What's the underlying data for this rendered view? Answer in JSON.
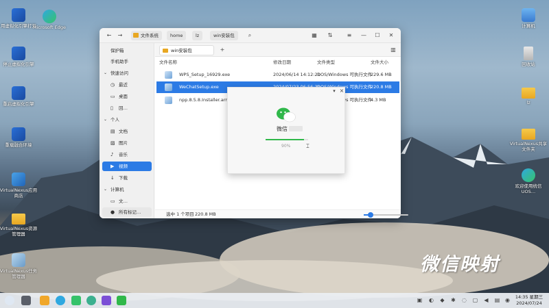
{
  "desktop_left": [
    {
      "name": "用虚拟化引擎打开",
      "icon": "vnexus-engine-icon"
    },
    {
      "name": "Microsoft Edge",
      "icon": "edge-icon"
    },
    {
      "name": "停止虚拟化引擎",
      "icon": "vnexus-stop-icon"
    },
    {
      "name": "重启虚拟化引擎",
      "icon": "vnexus-restart-icon"
    },
    {
      "name": "重载融合环境",
      "icon": "vnexus-reload-icon"
    },
    {
      "name": "VirtualNexus应用商店",
      "icon": "store-icon"
    },
    {
      "name": "VirtualNexus资源管理器",
      "icon": "folder-icon"
    },
    {
      "name": "VirtualNexus任务管理器",
      "icon": "task-manager-icon"
    }
  ],
  "desktop_right": [
    {
      "name": "计算机",
      "icon": "computer-icon"
    },
    {
      "name": "回收站",
      "icon": "recycle-bin-icon"
    },
    {
      "name": "lz",
      "icon": "folder-icon"
    },
    {
      "name": "VirtualNexus共享文件夹",
      "icon": "folder-icon"
    },
    {
      "name": "欢迎使用统信UOS…",
      "icon": "welcome-icon"
    }
  ],
  "window": {
    "breadcrumbs": [
      "文件系统",
      "home",
      "lz",
      "win安装包"
    ],
    "nav": {
      "back": "←",
      "forward": "→"
    },
    "controls": {
      "min": "—",
      "max": "☐",
      "close": "✕"
    },
    "sidebar": [
      {
        "label": "保护箱",
        "type": "top"
      },
      {
        "label": "手机助手",
        "type": "top"
      },
      {
        "label": "快速访问",
        "type": "group"
      },
      {
        "label": "最近",
        "type": "sub",
        "icon": "clock-icon"
      },
      {
        "label": "桌面",
        "type": "sub",
        "icon": "desktop-icon"
      },
      {
        "label": "回…",
        "type": "sub",
        "icon": "trash-icon"
      },
      {
        "label": "个人",
        "type": "group"
      },
      {
        "label": "文档",
        "type": "sub",
        "icon": "document-icon"
      },
      {
        "label": "图片",
        "type": "sub",
        "icon": "image-icon"
      },
      {
        "label": "音乐",
        "type": "sub",
        "icon": "music-icon"
      },
      {
        "label": "视频",
        "type": "sub",
        "icon": "video-icon",
        "active": true
      },
      {
        "label": "下载",
        "type": "sub",
        "icon": "download-icon"
      },
      {
        "label": "计算机",
        "type": "group"
      },
      {
        "label": "文…",
        "type": "sub",
        "icon": "drive-icon"
      },
      {
        "label": "所有标记…",
        "type": "sub",
        "icon": "tag-icon"
      }
    ],
    "tab": {
      "label": "win安装包",
      "add": "+"
    },
    "columns": [
      "文件名称",
      "修改日期",
      "文件类型",
      "文件大小"
    ],
    "files": [
      {
        "name": "WPS_Setup_16929.exe",
        "date": "2024/06/14 14:12:21",
        "type": "DOS/Windows 可执行文件",
        "size": "229.6 MB",
        "selected": false
      },
      {
        "name": "WeChatSetup.exe",
        "date": "2024/07/23 06:56:39",
        "type": "DOS/Windows 可执行文件",
        "size": "220.8 MB",
        "selected": true
      },
      {
        "name": "npp.8.5.8.Installer.arm64.exe",
        "date": "",
        "type": "DOS/Windows 可执行文件",
        "size": "4.3 MB",
        "selected": false
      }
    ],
    "status": {
      "selected": "选中 1 个项目",
      "size": "220.8 MB"
    },
    "zoom_fraction": 0.15
  },
  "installer": {
    "app_name": "微信",
    "progress_percent": 90,
    "progress_label": "90%",
    "pin": "▾",
    "close": "×"
  },
  "watermark": "微信映射",
  "clock": {
    "time": "14:35 星期三",
    "date": "2024/07/24"
  },
  "colors": {
    "accent": "#2c7be5",
    "wechat_green": "#30b84a"
  }
}
